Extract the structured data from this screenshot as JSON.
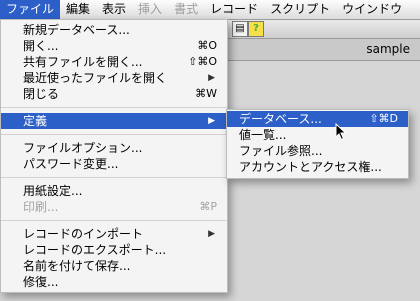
{
  "menubar": {
    "items": [
      {
        "label": "ファイル",
        "state": "active"
      },
      {
        "label": "編集",
        "state": "normal"
      },
      {
        "label": "表示",
        "state": "normal"
      },
      {
        "label": "挿入",
        "state": "disabled"
      },
      {
        "label": "書式",
        "state": "disabled"
      },
      {
        "label": "レコード",
        "state": "normal"
      },
      {
        "label": "スクリプト",
        "state": "normal"
      },
      {
        "label": "ウインドウ",
        "state": "normal"
      }
    ]
  },
  "window": {
    "title": "sample"
  },
  "file_menu": {
    "new_database": "新規データベース...",
    "open": "開く...",
    "open_shortcut": "⌘O",
    "open_shared": "共有ファイルを開く...",
    "open_shared_shortcut": "⇧⌘O",
    "open_recent": "最近使ったファイルを開く",
    "close": "閉じる",
    "close_shortcut": "⌘W",
    "define": "定義",
    "file_options": "ファイルオプション...",
    "change_password": "パスワード変更...",
    "page_setup": "用紙設定...",
    "print": "印刷...",
    "print_shortcut": "⌘P",
    "import_records": "レコードのインポート",
    "export_records": "レコードのエクスポート...",
    "save_as": "名前を付けて保存...",
    "recover": "修復..."
  },
  "define_submenu": {
    "database": "データベース...",
    "database_shortcut": "⇧⌘D",
    "value_lists": "値一覧...",
    "file_references": "ファイル参照...",
    "accounts": "アカウントとアクセス権..."
  },
  "colors": {
    "selection": "#2c5fc8",
    "menu_bg": "#f4f4f4",
    "disabled_text": "#a2a2a2"
  },
  "icons": {
    "submenu_arrow": "▶",
    "cursor": "arrow-cursor-icon"
  }
}
